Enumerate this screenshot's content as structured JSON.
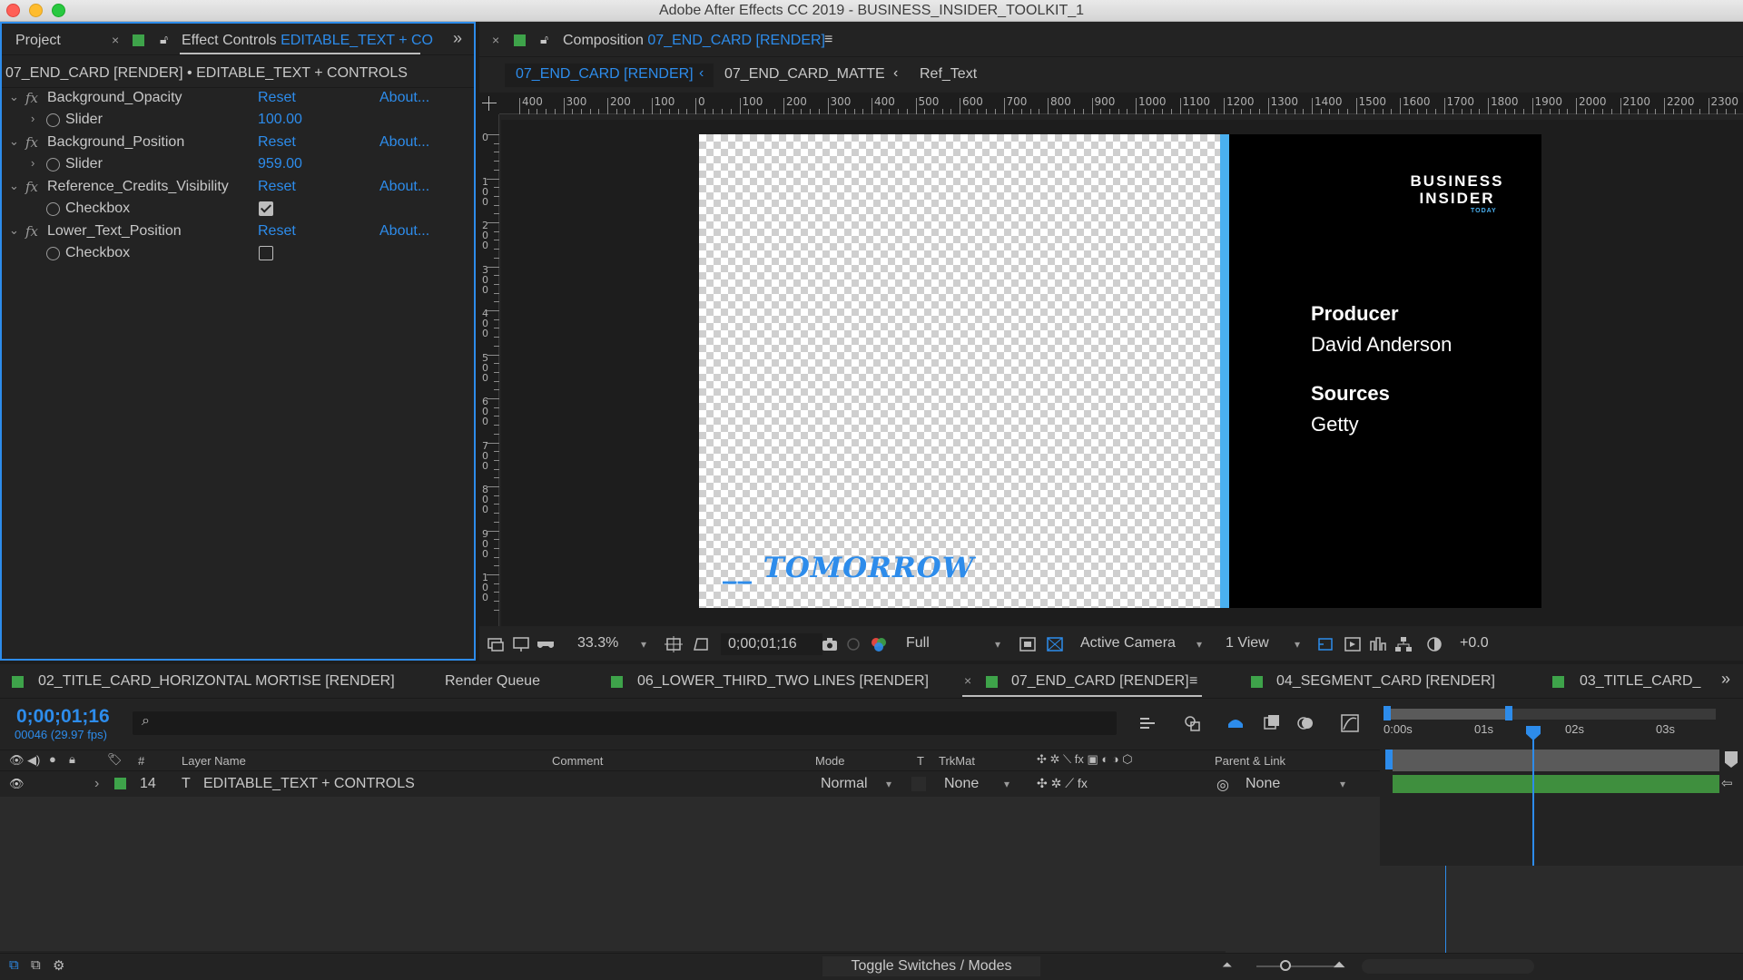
{
  "window": {
    "title": "Adobe After Effects CC 2019 - BUSINESS_INSIDER_TOOLKIT_1"
  },
  "left_panel": {
    "project_tab": "Project",
    "effect_controls_tab": "Effect Controls",
    "effect_controls_layer": "EDITABLE_TEXT + CO",
    "subtitle": "07_END_CARD [RENDER] • EDITABLE_TEXT + CONTROLS",
    "effects": [
      {
        "name": "Background_Opacity",
        "reset": "Reset",
        "about": "About...",
        "param": "Slider",
        "value": "100.00"
      },
      {
        "name": "Background_Position",
        "reset": "Reset",
        "about": "About...",
        "param": "Slider",
        "value": "959.00"
      },
      {
        "name": "Reference_Credits_Visibility",
        "reset": "Reset",
        "about": "About...",
        "param": "Checkbox",
        "checked": true
      },
      {
        "name": "Lower_Text_Position",
        "reset": "Reset",
        "about": "About...",
        "param": "Checkbox",
        "checked": false
      }
    ]
  },
  "composition": {
    "tab_label": "Composition",
    "tab_comp": "07_END_CARD [RENDER]",
    "breadcrumbs": [
      "07_END_CARD [RENDER]",
      "07_END_CARD_MATTE",
      "Ref_Text"
    ],
    "ruler_h": [
      "400",
      "300",
      "200",
      "100",
      "0",
      "100",
      "200",
      "300",
      "400",
      "500",
      "600",
      "700",
      "800",
      "900",
      "1000",
      "1100",
      "1200",
      "1300",
      "1400",
      "1500",
      "1600",
      "1700",
      "1800",
      "1900",
      "2000",
      "2100",
      "2200",
      "2300"
    ],
    "ruler_v": [
      "0",
      "1\n0\n0",
      "2\n0\n0",
      "3\n0\n0",
      "4\n0\n0",
      "5\n0\n0",
      "6\n0\n0",
      "7\n0\n0",
      "8\n0\n0",
      "9\n0\n0",
      "1\n0\n0"
    ],
    "card": {
      "logo_line1": "BUSINESS",
      "logo_line2": "INSIDER",
      "logo_sub": "TODAY",
      "producer_label": "Producer",
      "producer_name": "David Anderson",
      "sources_label": "Sources",
      "sources_value": "Getty"
    },
    "lower_text": "__ TOMORROW"
  },
  "viewer_bar": {
    "zoom": "33.3%",
    "timecode": "0;00;01;16",
    "resolution": "Full",
    "camera": "Active Camera",
    "views": "1 View",
    "exposure": "+0.0"
  },
  "timeline": {
    "tabs": [
      {
        "label": "02_TITLE_CARD_HORIZONTAL MORTISE [RENDER]",
        "chip": true
      },
      {
        "label": "Render Queue",
        "chip": false
      },
      {
        "label": "06_LOWER_THIRD_TWO LINES [RENDER]",
        "chip": true
      },
      {
        "label": "07_END_CARD [RENDER]",
        "chip": true,
        "active": true
      },
      {
        "label": "04_SEGMENT_CARD [RENDER]",
        "chip": true
      },
      {
        "label": "03_TITLE_CARD_",
        "chip": true
      }
    ],
    "current_time": "0;00;01;16",
    "frame_info": "00046 (29.97 fps)",
    "columns": {
      "num": "#",
      "layer_name": "Layer Name",
      "comment": "Comment",
      "mode": "Mode",
      "t": "T",
      "trkmat": "TrkMat",
      "parent": "Parent & Link"
    },
    "time_labels": [
      "0:00s",
      "01s",
      "02s",
      "03s"
    ],
    "layer": {
      "index": "14",
      "type": "T",
      "name": "EDITABLE_TEXT + CONTROLS",
      "mode": "Normal",
      "trkmat": "None",
      "parent": "None"
    },
    "toggle_label": "Toggle Switches / Modes"
  },
  "colors": {
    "accent": "#2d8ceb",
    "label_green": "#3ea34a",
    "card_blue": "#4ab0f0"
  }
}
